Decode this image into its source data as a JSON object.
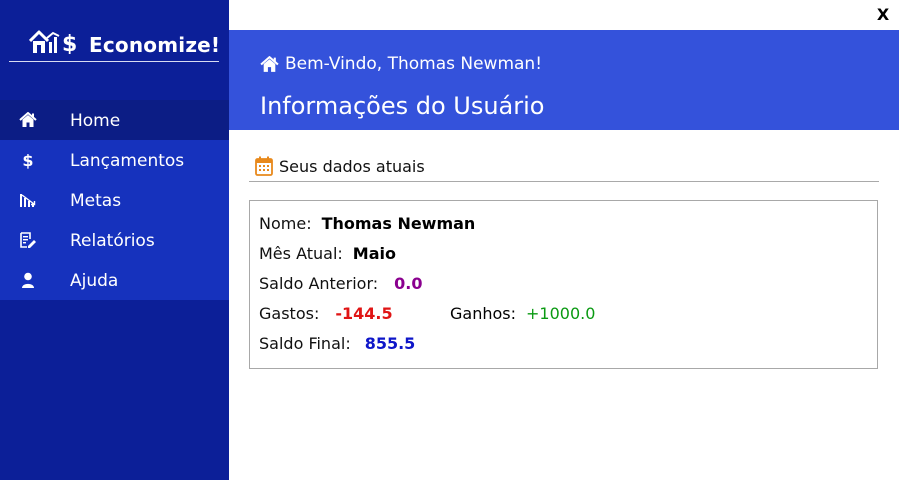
{
  "window": {
    "close_label": "X"
  },
  "brand": {
    "name": "Economize!",
    "logo_icon": "house-chart-dollar-icon"
  },
  "sidebar": {
    "items": [
      {
        "label": "Home",
        "icon": "home-icon",
        "active": true
      },
      {
        "label": "Lançamentos",
        "icon": "dollar-icon",
        "active": false
      },
      {
        "label": "Metas",
        "icon": "bar-chart-down-icon",
        "active": false
      },
      {
        "label": "Relatórios",
        "icon": "report-icon",
        "active": false
      },
      {
        "label": "Ajuda",
        "icon": "user-icon",
        "active": false
      }
    ],
    "dollar_glyph": "$"
  },
  "header": {
    "welcome": "Bem-Vindo, Thomas Newman!",
    "title": "Informações do Usuário"
  },
  "section": {
    "title": "Seus dados atuais",
    "icon": "calendar-icon"
  },
  "info": {
    "name_label": "Nome:",
    "name_value": "Thomas Newman",
    "month_label": "Mês Atual:",
    "month_value": "Maio",
    "previous_label": "Saldo Anterior:",
    "previous_value": "0.0",
    "spent_label": "Gastos:",
    "spent_value": "-144.5",
    "earned_label": "Ganhos:",
    "earned_value": "+1000.0",
    "final_label": "Saldo Final:",
    "final_value": "855.5"
  },
  "colors": {
    "sidebar_bg": "#0c1f98",
    "sidebar_active": "#0c1d85",
    "sidebar_item": "#1632bd",
    "header_bg": "#3452db",
    "previous": "#8a008f",
    "spent": "#e01515",
    "earned": "#0a9a12",
    "final": "#0e16c9",
    "calendar_icon": "#e8891c"
  }
}
